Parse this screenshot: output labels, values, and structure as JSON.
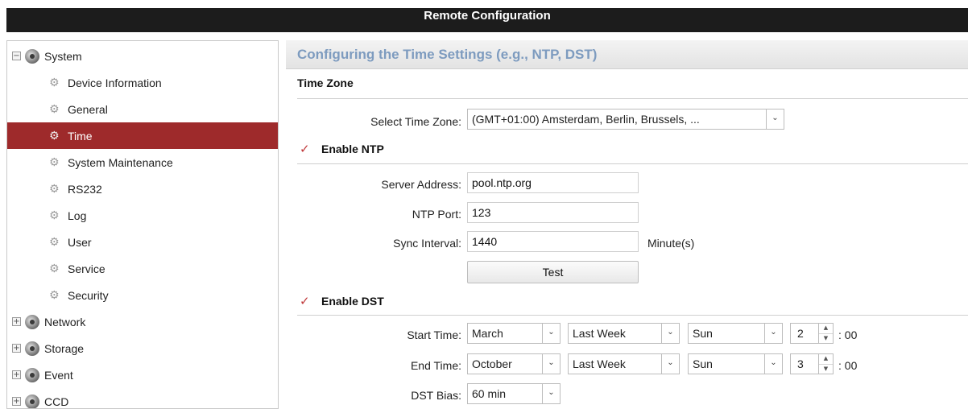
{
  "window": {
    "title": "Remote Configuration"
  },
  "sidebar": {
    "items": [
      {
        "label": "System",
        "expander": "−",
        "icon": "system-gear-icon"
      },
      {
        "label": "Device Information",
        "icon": "gear-icon"
      },
      {
        "label": "General",
        "icon": "gear-icon"
      },
      {
        "label": "Time",
        "icon": "gear-icon",
        "selected": true
      },
      {
        "label": "System Maintenance",
        "icon": "gear-icon"
      },
      {
        "label": "RS232",
        "icon": "gear-icon"
      },
      {
        "label": "Log",
        "icon": "gear-icon"
      },
      {
        "label": "User",
        "icon": "gear-icon"
      },
      {
        "label": "Service",
        "icon": "gear-icon"
      },
      {
        "label": "Security",
        "icon": "gear-icon"
      },
      {
        "label": "Network",
        "expander": "+",
        "icon": "system-gear-icon"
      },
      {
        "label": "Storage",
        "expander": "+",
        "icon": "system-gear-icon"
      },
      {
        "label": "Event",
        "expander": "+",
        "icon": "system-gear-icon"
      },
      {
        "label": "CCD",
        "expander": "+",
        "icon": "system-gear-icon"
      }
    ]
  },
  "main": {
    "title": "Configuring the Time Settings (e.g., NTP, DST)",
    "time_zone": {
      "heading": "Time Zone",
      "select_label": "Select Time Zone:",
      "select_value": "(GMT+01:00) Amsterdam, Berlin, Brussels, ..."
    },
    "ntp": {
      "checkbox_label": "Enable NTP",
      "checked": true,
      "server_label": "Server Address:",
      "server_value": "pool.ntp.org",
      "port_label": "NTP Port:",
      "port_value": "123",
      "interval_label": "Sync Interval:",
      "interval_value": "1440",
      "interval_unit": "Minute(s)",
      "test_button": "Test"
    },
    "dst": {
      "checkbox_label": "Enable DST",
      "checked": true,
      "start_label": "Start Time:",
      "start_month": "March",
      "start_week": "Last Week",
      "start_day": "Sun",
      "start_hour": "2",
      "start_minutes": ": 00",
      "end_label": "End Time:",
      "end_month": "October",
      "end_week": "Last Week",
      "end_day": "Sun",
      "end_hour": "3",
      "end_minutes": ": 00",
      "bias_label": "DST Bias:",
      "bias_value": "60 min"
    }
  },
  "symbols": {
    "check": "✓",
    "dropdown": "⌄",
    "spin_up": "▲",
    "spin_down": "▼",
    "gear": "⚙"
  },
  "colors": {
    "selection": "#9e2a2b",
    "title_accent": "#7d9bbf",
    "titlebar": "#1c1c1c"
  }
}
